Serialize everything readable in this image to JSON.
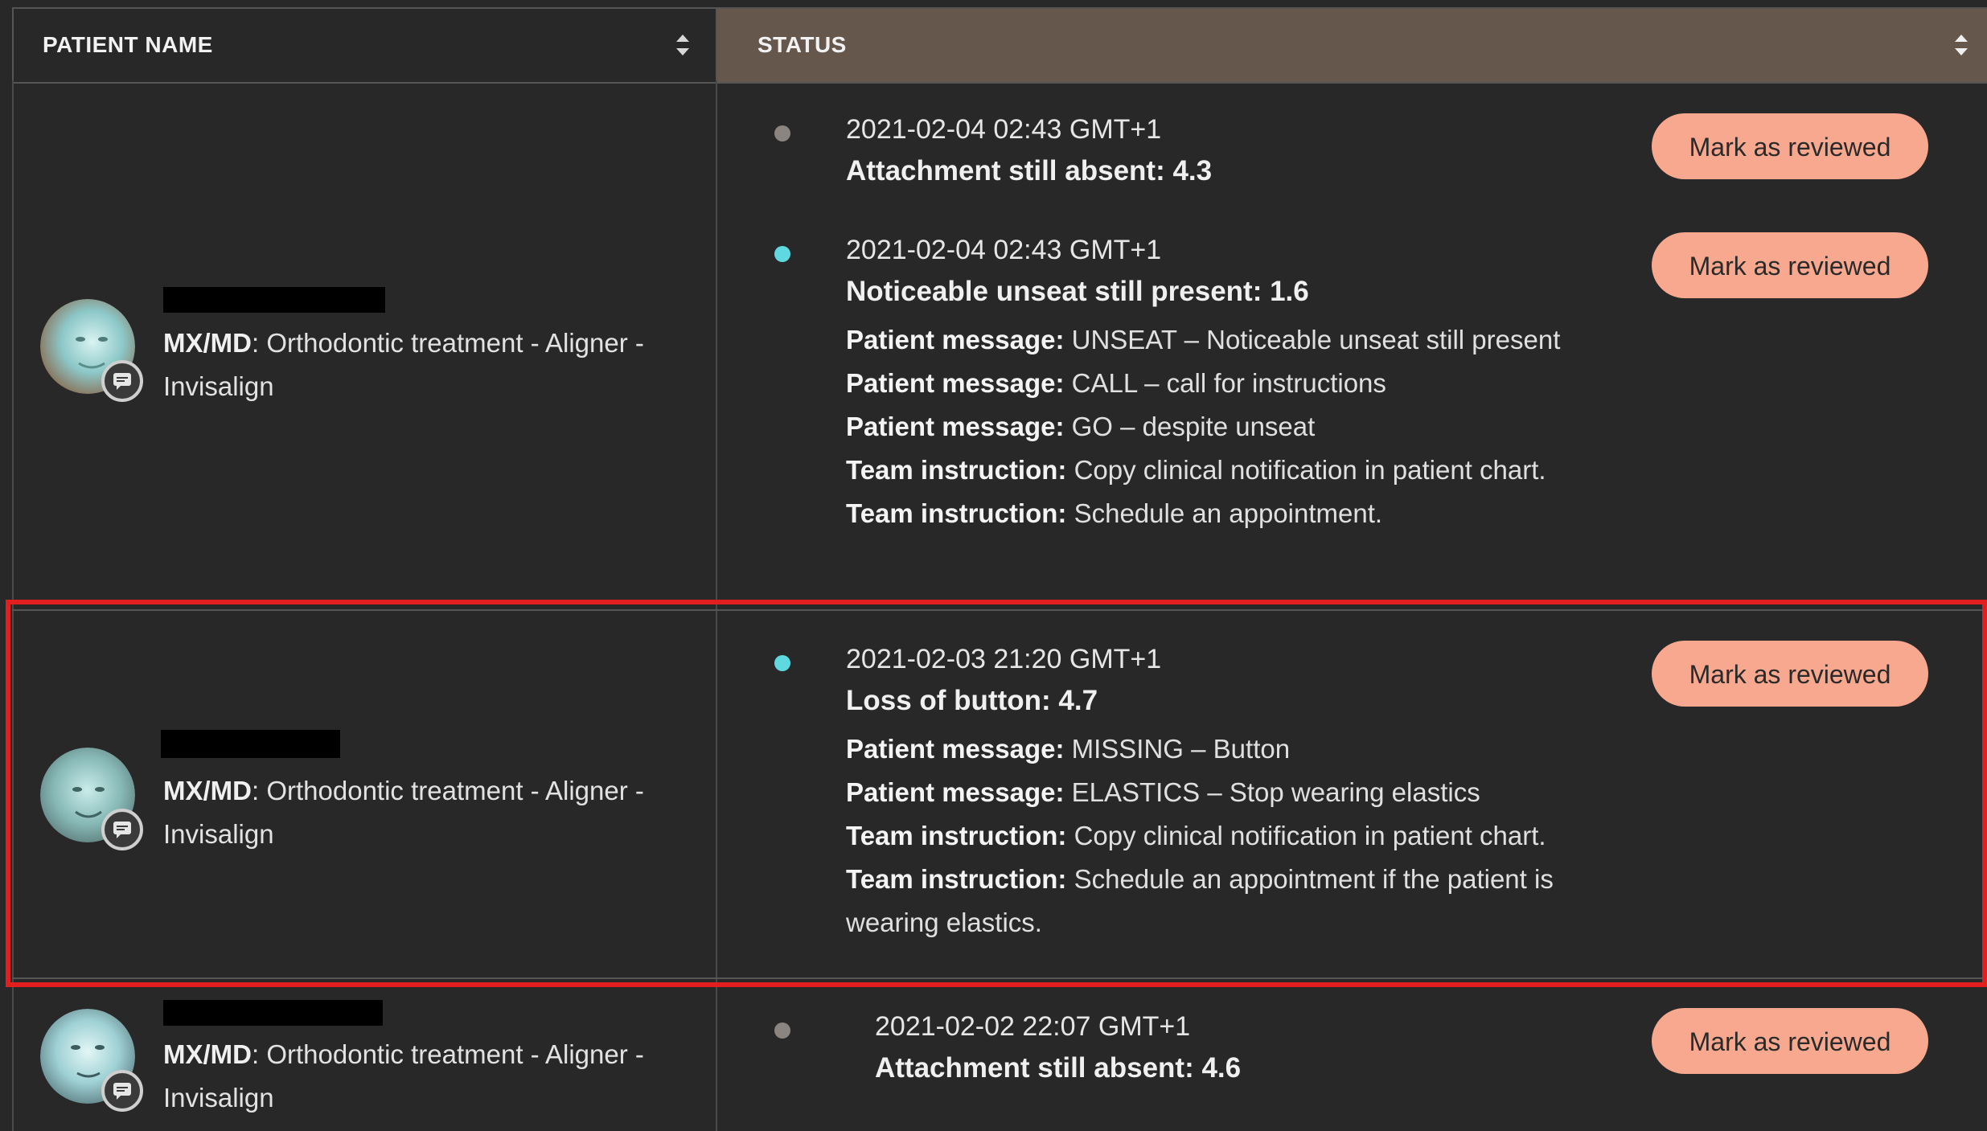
{
  "header": {
    "col_patient": "PATIENT NAME",
    "col_status": "STATUS"
  },
  "rows": [
    {
      "patient": {
        "label": "MX/MD",
        "treatment": ": Orthodontic treatment - Aligner - Invisalign"
      },
      "events": [
        {
          "timestamp": "2021-02-04 02:43 GMT+1",
          "title": "Attachment still absent: 4.3",
          "button": "Mark as reviewed",
          "dot_color": "#8a8580"
        },
        {
          "timestamp": "2021-02-04 02:43 GMT+1",
          "title": "Noticeable unseat still present: 1.6",
          "button": "Mark as reviewed",
          "dot_color": "#5fd8e0",
          "details": [
            {
              "label": "Patient message:",
              "text": " UNSEAT – Noticeable unseat still present"
            },
            {
              "label": "Patient message:",
              "text": " CALL – call for instructions"
            },
            {
              "label": "Patient message:",
              "text": " GO – despite unseat"
            },
            {
              "label": "Team instruction:",
              "text": " Copy clinical notification in patient chart."
            },
            {
              "label": "Team instruction:",
              "text": " Schedule an appointment."
            }
          ]
        }
      ]
    },
    {
      "patient": {
        "label": "MX/MD",
        "treatment": ": Orthodontic treatment - Aligner - Invisalign"
      },
      "events": [
        {
          "timestamp": "2021-02-03 21:20 GMT+1",
          "title": "Loss of button: 4.7",
          "button": "Mark as reviewed",
          "dot_color": "#5fd8e0",
          "details": [
            {
              "label": "Patient message:",
              "text": " MISSING – Button"
            },
            {
              "label": "Patient message:",
              "text": " ELASTICS – Stop wearing elastics"
            },
            {
              "label": "Team instruction:",
              "text": " Copy clinical notification in patient chart."
            },
            {
              "label": "Team instruction:",
              "text": " Schedule an appointment if the patient is wearing elastics."
            }
          ]
        }
      ]
    },
    {
      "patient": {
        "label": "MX/MD",
        "treatment": ": Orthodontic treatment - Aligner - Invisalign"
      },
      "events": [
        {
          "timestamp": "2021-02-02 22:07 GMT+1",
          "title": "Attachment still absent: 4.6",
          "button": "Mark as reviewed",
          "dot_color": "#8a8580"
        }
      ]
    }
  ]
}
